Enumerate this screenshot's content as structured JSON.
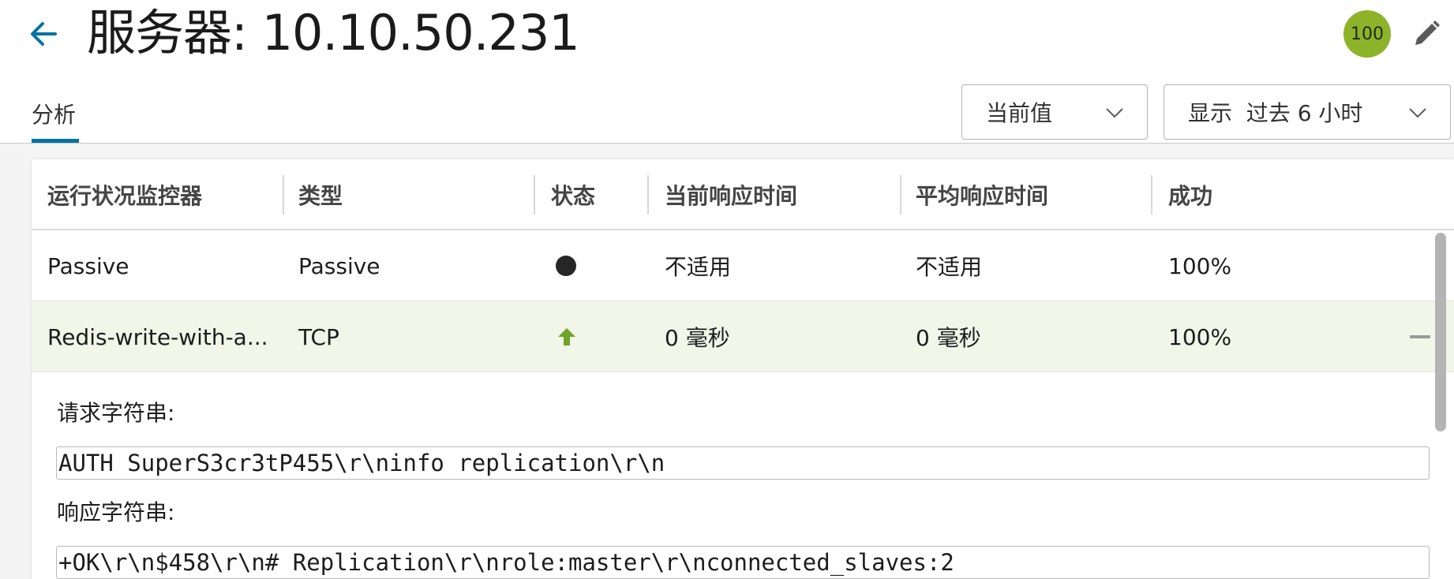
{
  "header": {
    "title": "服务器: 10.10.50.231",
    "score": "100"
  },
  "tabs": [
    {
      "label": "分析"
    }
  ],
  "filters": {
    "value_select": "当前值",
    "range_select": "显示  过去 6 小时"
  },
  "table": {
    "columns": [
      "运行状况监控器",
      "类型",
      "状态",
      "当前响应时间",
      "平均响应时间",
      "成功"
    ],
    "rows": [
      {
        "monitor": "Passive",
        "type": "Passive",
        "status": "status-dot",
        "current": "不适用",
        "average": "不适用",
        "success": "100%"
      },
      {
        "monitor": "Redis-write-with-a...",
        "type": "TCP",
        "status": "up-arrow",
        "current": "0 毫秒",
        "average": "0 毫秒",
        "success": "100%"
      }
    ]
  },
  "detail": {
    "request_label": "请求字符串:",
    "request_value": "AUTH SuperS3cr3tP455\\r\\ninfo replication\\r\\n",
    "response_label": "响应字符串:",
    "response_value": "+OK\\r\\n$458\\r\\n# Replication\\r\\nrole:master\\r\\nconnected_slaves:2"
  },
  "colors": {
    "accent": "#0072a3",
    "score_badge": "#8db32a",
    "status_up": "#6fa32a",
    "selected_row": "#f1f6e9"
  }
}
